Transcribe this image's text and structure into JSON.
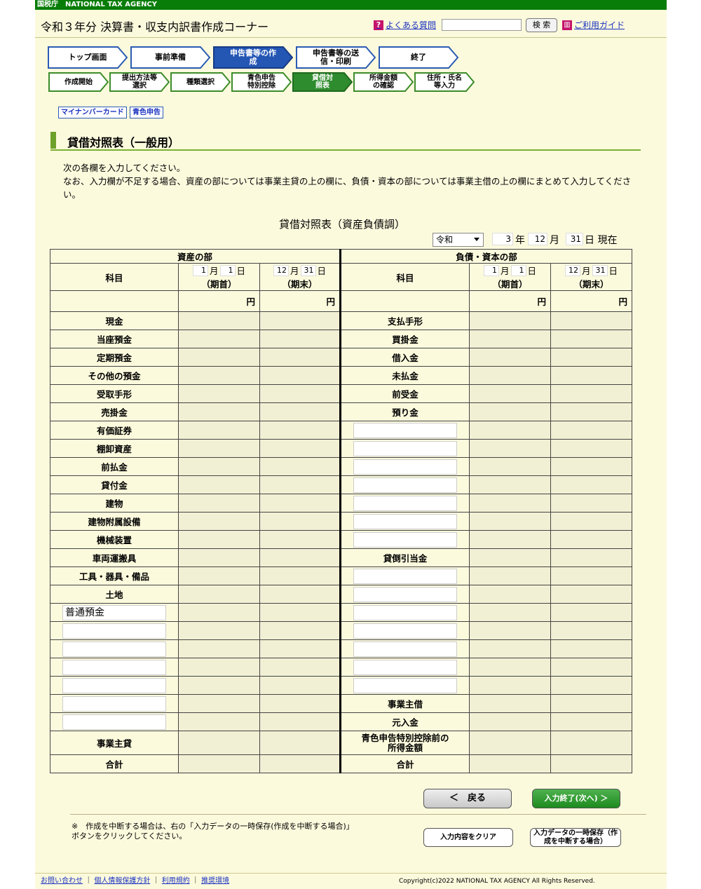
{
  "agency": "国税庁　NATIONAL TAX AGENCY",
  "header": {
    "title": "令和３年分 決算書・収支内訳書作成コーナー",
    "faq": "よくある質問",
    "search_btn": "検 索",
    "guide": "ご利用ガイド"
  },
  "steps": [
    "トップ画面",
    "事前準備",
    "申告書等の作成",
    "申告書等の送信・印刷",
    "終了"
  ],
  "substeps": [
    "作成開始",
    "提出方法等選択",
    "種類選択",
    "青色申告特別控除",
    "貸借対照表",
    "所得金額の確認",
    "住所・氏名等入力"
  ],
  "tags": [
    "マイナンバーカード",
    "青色申告"
  ],
  "section_title": "貸借対照表（一般用）",
  "intro1": "次の各欄を入力してください。",
  "intro2": "なお、入力欄が不足する場合、資産の部については事業主貸の上の欄に、負債・資本の部については事業主借の上の欄にまとめて入力してください。",
  "table_title": "貸借対照表（資産負債調）",
  "era": "令和",
  "date": {
    "year": "3",
    "year_label": "年",
    "month": "12",
    "month_label": "月",
    "day": "31",
    "day_label": "日 現在"
  },
  "assets_head": "資産の部",
  "liab_head": "負債・資本の部",
  "col_item": "科目",
  "start_label": "（期首）",
  "end_label": "（期末）",
  "start_month": "1",
  "start_day": "1",
  "end_month": "12",
  "end_day": "31",
  "month_label": "月",
  "day_label": "日",
  "yen": "円",
  "assets": [
    "現金",
    "当座預金",
    "定期預金",
    "その他の預金",
    "受取手形",
    "売掛金",
    "有価証券",
    "棚卸資産",
    "前払金",
    "貸付金",
    "建物",
    "建物附属設備",
    "機械装置",
    "車両運搬具",
    "工具・器具・備品",
    "土地"
  ],
  "asset_custom": "普通預金",
  "liabilities": [
    "支払手形",
    "買掛金",
    "借入金",
    "未払金",
    "前受金",
    "預り金"
  ],
  "allowance": "貸倒引当金",
  "owner_borrow": "事業主借",
  "capital": "元入金",
  "owner_loan": "事業主貸",
  "pre_income": "青色申告特別控除前の所得金額",
  "total": "合計",
  "buttons": {
    "back": "＜　戻る",
    "next": "入力終了(次へ) ＞",
    "clear": "入力内容をクリア",
    "save": "入力データの一時保存（作成を中断する場合）"
  },
  "note": "※　作成を中断する場合は、右の「入力データの一時保存(作成を中断する場合)」ボタンをクリックしてください。",
  "footer": {
    "links": [
      "お問い合わせ",
      "個人情報保護方針",
      "利用規約",
      "推奨環境"
    ],
    "copyright": "Copyright(c)2022 NATIONAL TAX AGENCY All Rights Reserved."
  }
}
